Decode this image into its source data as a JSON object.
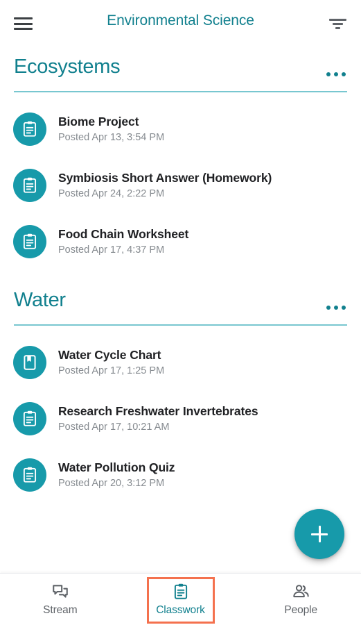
{
  "appbar": {
    "menu_icon": "hamburger-menu-icon",
    "title": "Environmental Science",
    "filter_icon": "filter-list-icon"
  },
  "topics": [
    {
      "title": "Ecosystems",
      "more_icon": "more-options-icon",
      "items": [
        {
          "icon": "assignment-clipboard-icon",
          "title": "Biome Project",
          "subtitle": "Posted Apr 13, 3:54 PM"
        },
        {
          "icon": "assignment-clipboard-icon",
          "title": "Symbiosis Short Answer (Homework)",
          "subtitle": "Posted Apr 24, 2:22 PM"
        },
        {
          "icon": "assignment-clipboard-icon",
          "title": "Food Chain Worksheet",
          "subtitle": "Posted Apr 17, 4:37 PM"
        }
      ]
    },
    {
      "title": "Water",
      "more_icon": "more-options-icon",
      "items": [
        {
          "icon": "material-book-icon",
          "title": "Water Cycle Chart",
          "subtitle": "Posted Apr 17, 1:25 PM"
        },
        {
          "icon": "assignment-clipboard-icon",
          "title": "Research Freshwater Invertebrates",
          "subtitle": "Posted Apr 17, 10:21 AM"
        },
        {
          "icon": "assignment-clipboard-icon",
          "title": "Water Pollution Quiz",
          "subtitle": "Posted Apr 20, 3:12 PM"
        }
      ]
    }
  ],
  "fab": {
    "icon": "plus-icon",
    "label": "Create"
  },
  "bottom_nav": {
    "active_index": 1,
    "tabs": [
      {
        "label": "Stream",
        "icon": "forum-icon"
      },
      {
        "label": "Classwork",
        "icon": "assignment-clipboard-icon"
      },
      {
        "label": "People",
        "icon": "people-icon"
      }
    ]
  },
  "colors": {
    "teal": "#11808e",
    "icon_teal": "#179AAA",
    "rule_teal": "#78c7d0",
    "highlight": "#f4714e",
    "title_text": "#202124",
    "subtitle_text": "#868b90"
  }
}
